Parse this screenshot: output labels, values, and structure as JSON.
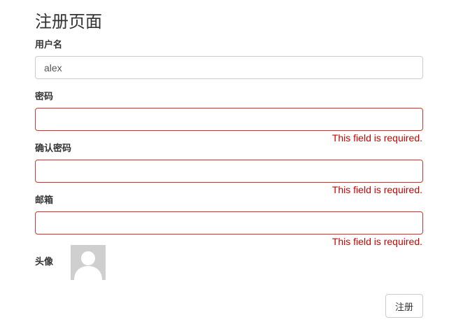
{
  "page": {
    "title": "注册页面"
  },
  "form": {
    "username": {
      "label": "用户名",
      "value": "alex"
    },
    "password": {
      "label": "密码",
      "value": "",
      "error": "This field is required."
    },
    "confirm_password": {
      "label": "确认密码",
      "value": "",
      "error": "This field is required."
    },
    "email": {
      "label": "邮箱",
      "value": "",
      "error": "This field is required."
    },
    "avatar": {
      "label": "头像",
      "icon": "default-avatar-icon"
    },
    "submit_label": "注册"
  },
  "colors": {
    "error_text": "#cc0000",
    "error_border": "#a94442",
    "avatar_bg": "#cfcfcf"
  }
}
